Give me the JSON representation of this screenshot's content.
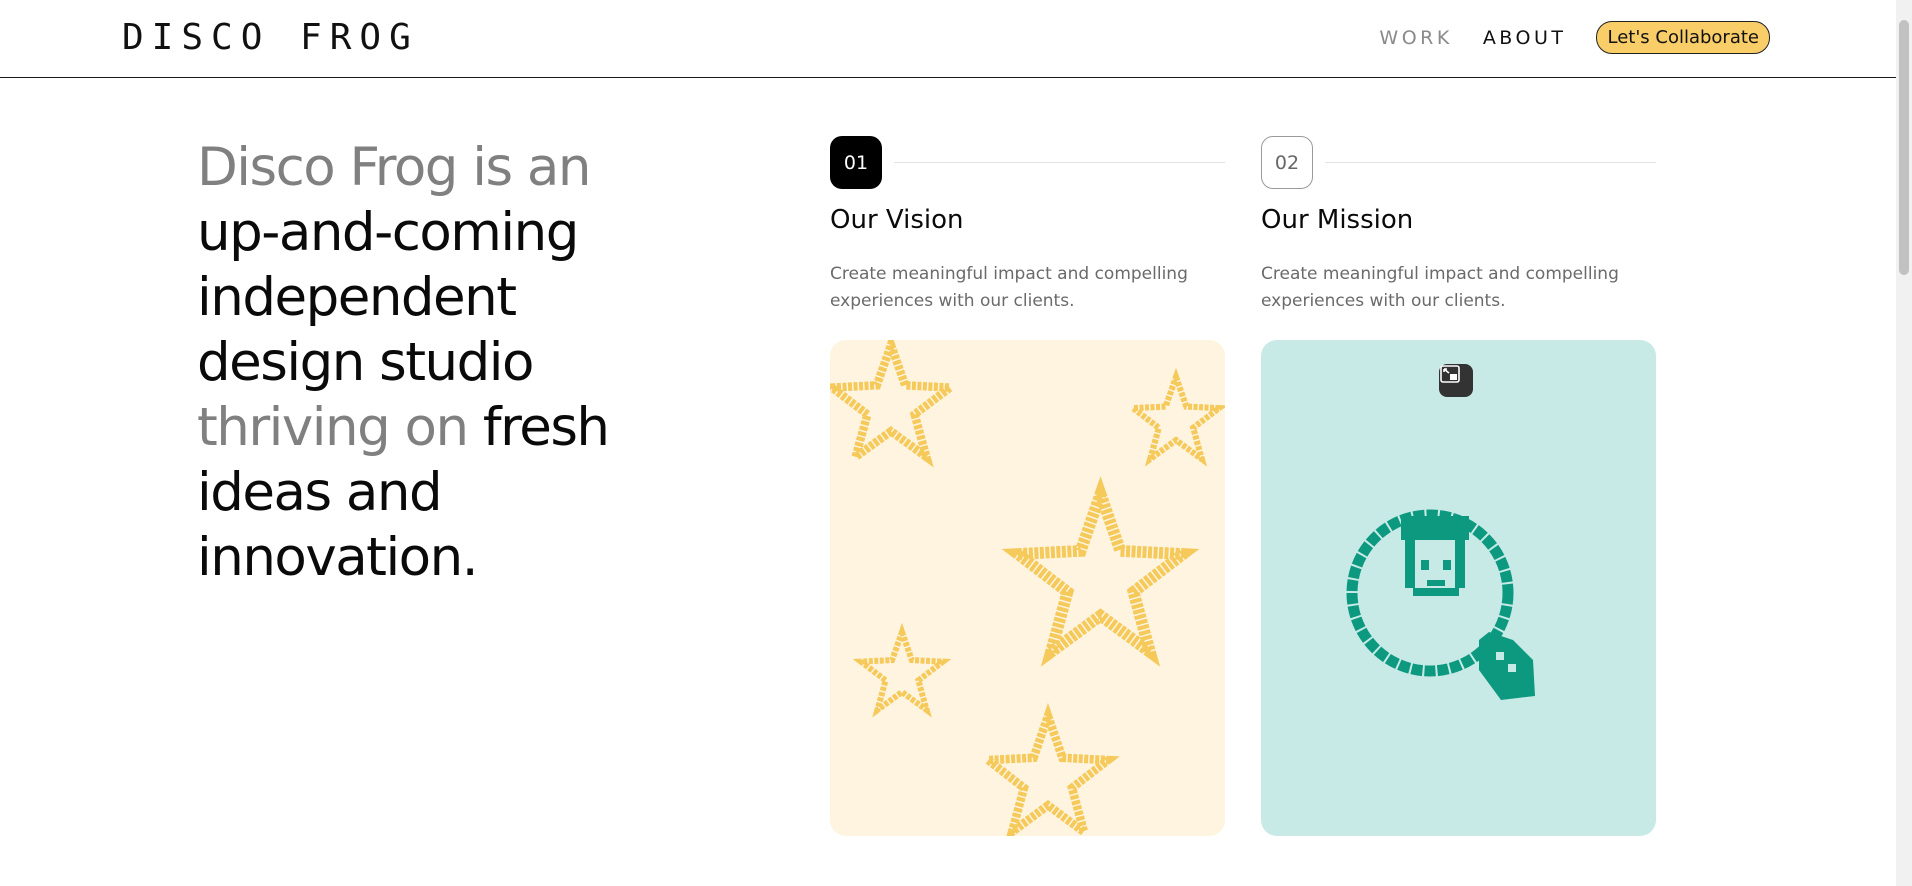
{
  "header": {
    "logo": "DISCO FROG",
    "nav": {
      "work": "WORK",
      "about": "ABOUT",
      "cta": "Let's Collaborate"
    }
  },
  "hero": {
    "muted_1": "Disco Frog is an",
    "line_2": "up-and-coming",
    "line_3": "independent",
    "line_4": "design studio",
    "muted_5": "thriving on",
    "line_5_rest": " fresh",
    "line_6": "ideas and",
    "line_7": "innovation."
  },
  "cards": [
    {
      "number": "01",
      "title": "Our Vision",
      "description": "Create meaningful impact and compelling experiences with our clients.",
      "illustration": "pixel-stars"
    },
    {
      "number": "02",
      "title": "Our Mission",
      "description": "Create meaningful impact and compelling experiences with our clients.",
      "illustration": "pixel-magnifier-face"
    }
  ],
  "colors": {
    "accent": "#f9cd68",
    "yellow_panel": "#fef4e0",
    "teal_panel": "#c7eae6",
    "star": "#f5c95a",
    "teal_icon": "#0d9980"
  },
  "icons": {
    "expand": "expand-icon"
  }
}
